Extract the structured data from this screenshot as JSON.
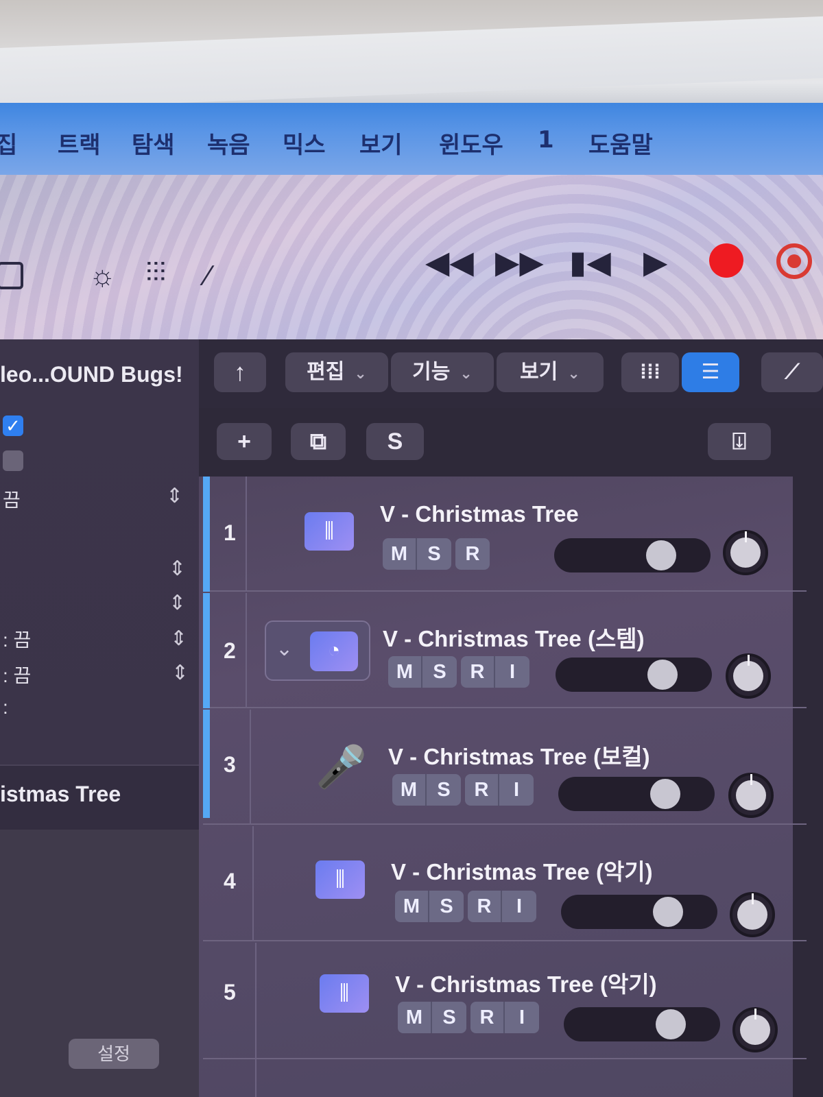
{
  "menu": {
    "items": [
      "집",
      "트랙",
      "탐색",
      "녹음",
      "믹스",
      "보기",
      "윈도우",
      "1",
      "도움말"
    ]
  },
  "toolbar": {
    "icons": [
      "library-icon",
      "brightness-icon",
      "mixer-icon",
      "pencil-icon"
    ],
    "transport": [
      "rewind-icon",
      "fast-forward-icon",
      "go-to-start-icon",
      "play-icon",
      "record-icon",
      "cycle-icon"
    ]
  },
  "inspector": {
    "title": "leo...OUND Bugs!",
    "row_off_label_1": "끔",
    "row_off_label_2": ": 끔",
    "row_off_label_3": ": 끔",
    "row_colon": ":",
    "track_name": "istmas Tree",
    "settings_label": "설정"
  },
  "tracks_header": {
    "edit_label": "편집",
    "functions_label": "기능",
    "view_label": "보기",
    "add_label": "+",
    "s_label": "S"
  },
  "tracks": [
    {
      "number": "1",
      "name": "V - Christmas Tree",
      "m": "M",
      "s": "S",
      "r": "R",
      "icon": "waveform-icon",
      "volume": 0.72
    },
    {
      "number": "2",
      "name": "V - Christmas Tree (스템)",
      "m": "M",
      "s": "S",
      "r": "R",
      "i": "I",
      "icon": "stem-icon",
      "volume": 0.72
    },
    {
      "number": "3",
      "name": "V - Christmas Tree (보컬)",
      "m": "M",
      "s": "S",
      "r": "R",
      "i": "I",
      "icon": "microphone-icon",
      "volume": 0.72
    },
    {
      "number": "4",
      "name": "V - Christmas Tree  (악기)",
      "m": "M",
      "s": "S",
      "r": "R",
      "i": "I",
      "icon": "waveform-icon",
      "volume": 0.72
    },
    {
      "number": "5",
      "name": "V - Christmas Tree  (악기)",
      "m": "M",
      "s": "S",
      "r": "R",
      "i": "I",
      "icon": "waveform-icon",
      "volume": 0.72
    }
  ],
  "colors": {
    "menubar": "#4a8ce4",
    "record": "#ee1b22",
    "accent": "#2e7de6",
    "selection": "#55a8f5"
  }
}
